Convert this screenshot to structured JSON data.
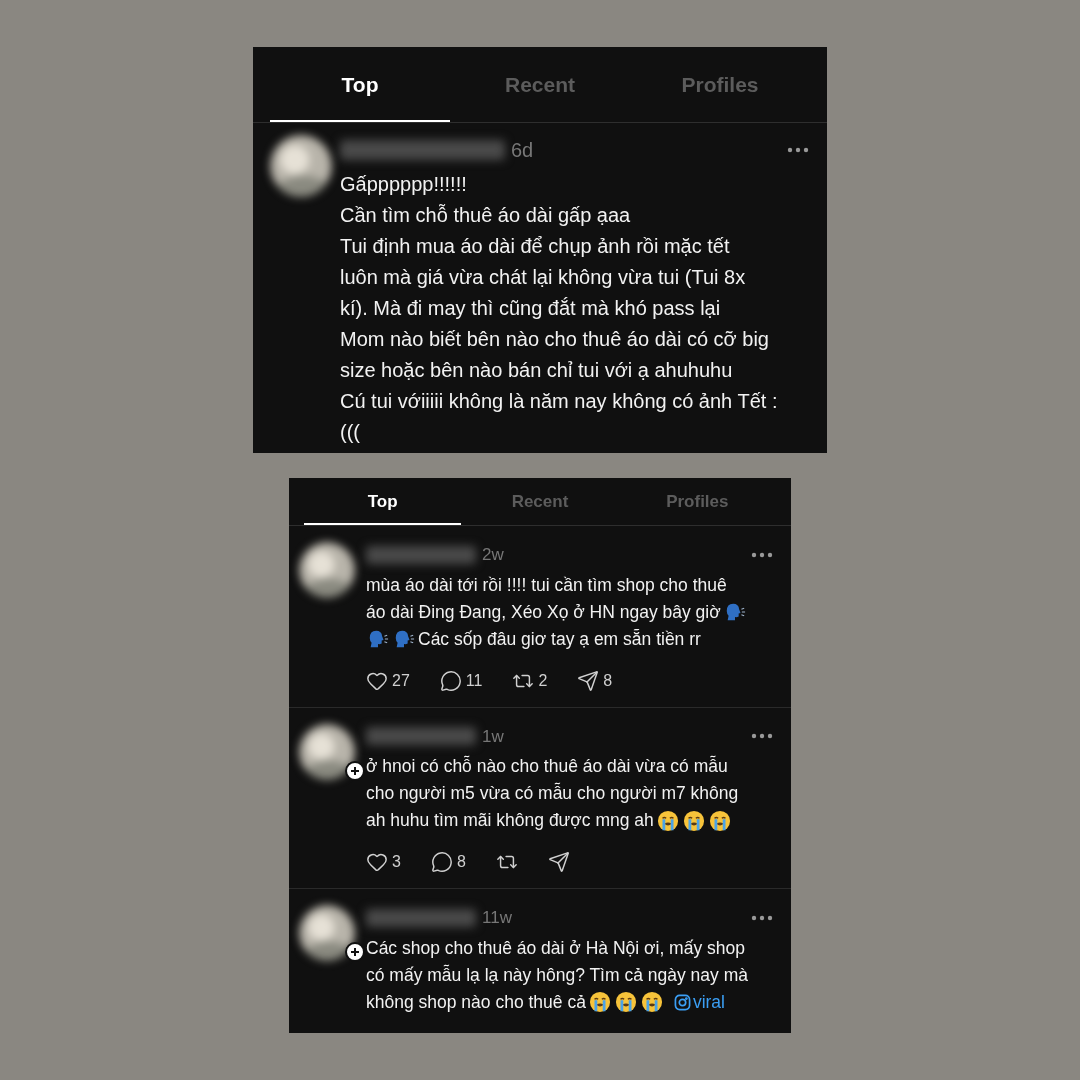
{
  "panels": [
    {
      "tabs": [
        {
          "label": "Top",
          "selected": true
        },
        {
          "label": "Recent",
          "selected": false
        },
        {
          "label": "Profiles",
          "selected": false
        }
      ],
      "posts": [
        {
          "time": "6d",
          "follow_badge": false,
          "lines": [
            [
              {
                "kind": "text",
                "text": "Gấpppppp!!!!!!"
              }
            ],
            [
              {
                "kind": "text",
                "text": "Cần tìm chỗ thuê áo dài gấp ạaa"
              }
            ],
            [
              {
                "kind": "text",
                "text": "Tui định mua áo dài để chụp ảnh rồi mặc tết"
              }
            ],
            [
              {
                "kind": "text",
                "text": "luôn mà giá vừa chát lại không vừa tui (Tui 8x"
              }
            ],
            [
              {
                "kind": "text",
                "text": "kí). Mà đi may thì cũng đắt mà khó pass lại"
              }
            ],
            [
              {
                "kind": "text",
                "text": "Mom nào biết bên nào cho thuê áo dài có cỡ big"
              }
            ],
            [
              {
                "kind": "text",
                "text": "size hoặc bên nào bán chỉ tui với ạ ahuhuhu"
              }
            ],
            [
              {
                "kind": "text",
                "text": "Cú tui vớiiiii không là năm nay không có ảnh Tết :"
              }
            ],
            [
              {
                "kind": "text",
                "text": "((("
              }
            ]
          ]
        }
      ]
    },
    {
      "tabs": [
        {
          "label": "Top",
          "selected": true
        },
        {
          "label": "Recent",
          "selected": false
        },
        {
          "label": "Profiles",
          "selected": false
        }
      ],
      "posts": [
        {
          "time": "2w",
          "follow_badge": false,
          "lines": [
            [
              {
                "kind": "text",
                "text": "mùa áo dài tới rồi !!!! tui cần tìm shop cho thuê"
              }
            ],
            [
              {
                "kind": "text",
                "text": "áo dài Đing Đang, Xéo Xọ ở HN ngay bây giờ"
              },
              {
                "kind": "speaking"
              }
            ],
            [
              {
                "kind": "speaking"
              },
              {
                "kind": "speaking"
              },
              {
                "kind": "text",
                "text": "Các sốp đâu giơ tay ạ em sẵn tiền rr"
              }
            ]
          ],
          "actions": [
            {
              "kind": "like",
              "count": "27"
            },
            {
              "kind": "reply",
              "count": "11"
            },
            {
              "kind": "repost",
              "count": "2"
            },
            {
              "kind": "share",
              "count": "8"
            }
          ]
        },
        {
          "time": "1w",
          "follow_badge": true,
          "lines": [
            [
              {
                "kind": "text",
                "text": "ở hnoi có chỗ nào cho thuê áo dài vừa có mẫu"
              }
            ],
            [
              {
                "kind": "text",
                "text": "cho người m5 vừa có mẫu cho người m7 không"
              }
            ],
            [
              {
                "kind": "text",
                "text": "ah huhu tìm mãi không được mng ah"
              },
              {
                "kind": "crying"
              },
              {
                "kind": "crying"
              },
              {
                "kind": "crying"
              }
            ]
          ],
          "actions": [
            {
              "kind": "like",
              "count": "3"
            },
            {
              "kind": "reply",
              "count": "8"
            },
            {
              "kind": "repost"
            },
            {
              "kind": "share"
            }
          ]
        },
        {
          "time": "11w",
          "follow_badge": true,
          "lines": [
            [
              {
                "kind": "text",
                "text": "Các shop cho thuê áo dài ở Hà Nội ơi, mấy shop"
              }
            ],
            [
              {
                "kind": "text",
                "text": "có mấy mẫu lạ lạ này hông? Tìm cả ngày nay mà"
              }
            ],
            [
              {
                "kind": "text",
                "text": "không shop nào cho thuê cả"
              },
              {
                "kind": "crying"
              },
              {
                "kind": "crying"
              },
              {
                "kind": "crying"
              },
              {
                "kind": "link",
                "text": "viral"
              }
            ]
          ]
        }
      ]
    }
  ]
}
